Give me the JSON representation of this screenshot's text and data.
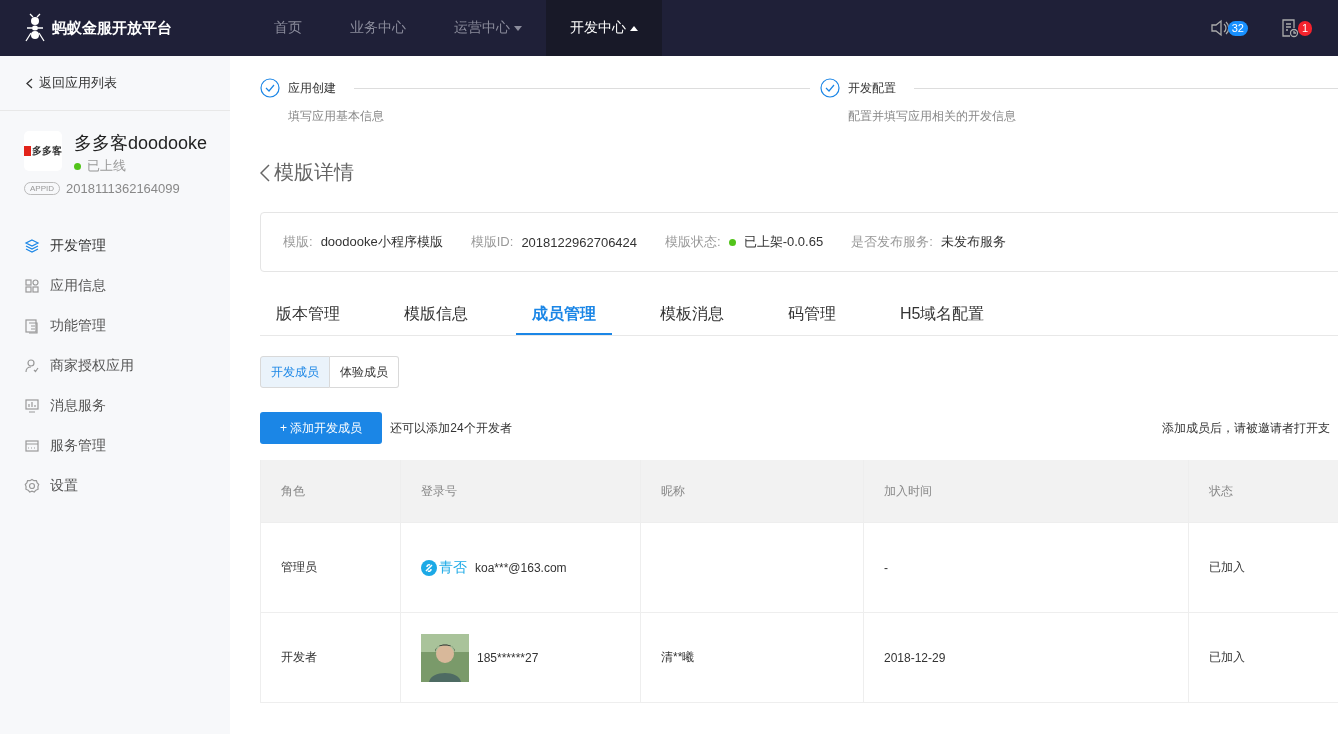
{
  "topbar": {
    "brand": "蚂蚁金服开放平台",
    "nav": [
      {
        "label": "首页",
        "selected": false,
        "dropdown": false
      },
      {
        "label": "业务中心",
        "selected": false,
        "dropdown": false
      },
      {
        "label": "运营中心",
        "selected": false,
        "dropdown": true
      },
      {
        "label": "开发中心",
        "selected": true,
        "dropdown": true
      }
    ],
    "notifications": [
      {
        "kind": "speaker",
        "count": "32",
        "color": "#1890ff"
      },
      {
        "kind": "todo",
        "count": "1",
        "color": "#f5222d"
      }
    ]
  },
  "sidebar": {
    "back": "返回应用列表",
    "app": {
      "logo_text": "多多客",
      "name": "多多客doodooke",
      "status": "已上线",
      "appid_tag": "APPID",
      "appid": "2018111362164099"
    },
    "items": [
      {
        "label": "开发管理",
        "selected": true
      },
      {
        "label": "应用信息",
        "selected": false
      },
      {
        "label": "功能管理",
        "selected": false
      },
      {
        "label": "商家授权应用",
        "selected": false
      },
      {
        "label": "消息服务",
        "selected": false
      },
      {
        "label": "服务管理",
        "selected": false
      },
      {
        "label": "设置",
        "selected": false
      }
    ]
  },
  "steps": [
    {
      "title": "应用创建",
      "desc": "填写应用基本信息"
    },
    {
      "title": "开发配置",
      "desc": "配置并填写应用相关的开发信息"
    }
  ],
  "page_title": "模版详情",
  "info": [
    {
      "label": "模版:",
      "value": "doodooke小程序模版",
      "dot": false
    },
    {
      "label": "模版ID:",
      "value": "2018122962706424",
      "dot": false
    },
    {
      "label": "模版状态:",
      "value": "已上架-0.0.65",
      "dot": true
    },
    {
      "label": "是否发布服务:",
      "value": "未发布服务",
      "dot": false
    }
  ],
  "tabs": [
    {
      "label": "版本管理",
      "selected": false
    },
    {
      "label": "模版信息",
      "selected": false
    },
    {
      "label": "成员管理",
      "selected": true
    },
    {
      "label": "模板消息",
      "selected": false
    },
    {
      "label": "码管理",
      "selected": false
    },
    {
      "label": "H5域名配置",
      "selected": false
    }
  ],
  "segments": [
    {
      "label": "开发成员",
      "selected": true
    },
    {
      "label": "体验成员",
      "selected": false
    }
  ],
  "add_button": "+ 添加开发成员",
  "quota": "还可以添加24个开发者",
  "hint": "添加成员后，请被邀请者打开支",
  "table": {
    "columns": [
      "角色",
      "登录号",
      "昵称",
      "加入时间",
      "状态"
    ],
    "rows": [
      {
        "role": "管理员",
        "kind": "logo",
        "logo_text": "青否",
        "login": "koa***@163.com",
        "joined": "-",
        "status": "已加入"
      },
      {
        "role": "开发者",
        "kind": "picture",
        "login": "185******27",
        "nickname": "清**曦",
        "joined": "2018-12-29",
        "status": "已加入"
      }
    ]
  }
}
